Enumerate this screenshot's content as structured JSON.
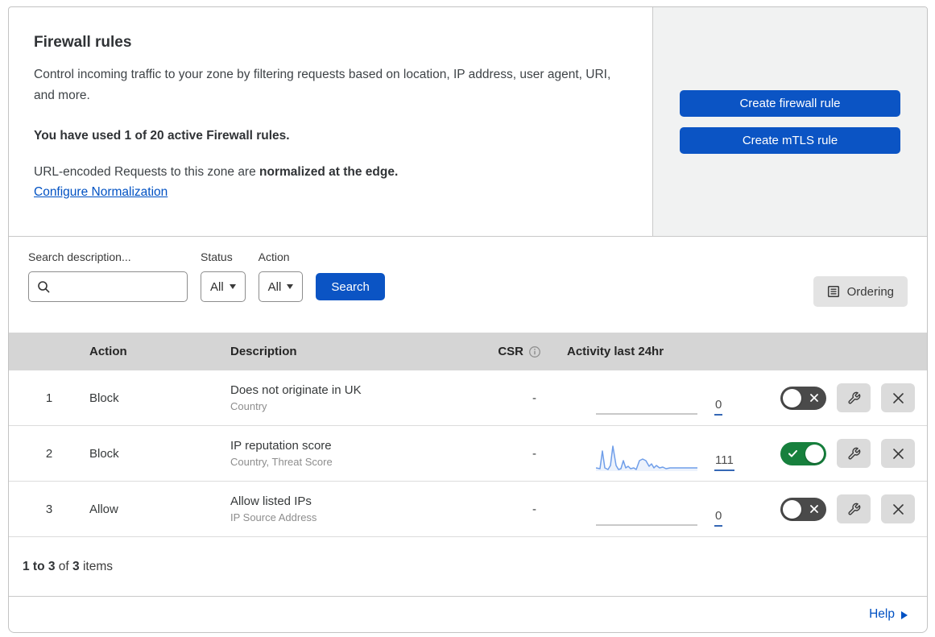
{
  "header": {
    "title": "Firewall rules",
    "description": "Control incoming traffic to your zone by filtering requests based on location, IP address, user agent, URI, and more.",
    "usage": "You have used 1 of 20 active Firewall rules.",
    "normalization_prefix": "URL-encoded Requests to this zone are ",
    "normalization_bold": "normalized at the edge.",
    "configure_link": "Configure Normalization",
    "create_firewall_button": "Create firewall rule",
    "create_mtls_button": "Create mTLS rule"
  },
  "filters": {
    "search_label": "Search description...",
    "search_value": "",
    "status_label": "Status",
    "status_value": "All",
    "action_label": "Action",
    "action_value": "All",
    "search_button": "Search",
    "ordering_button": "Ordering"
  },
  "table": {
    "columns": {
      "action": "Action",
      "description": "Description",
      "csr": "CSR",
      "activity": "Activity last 24hr"
    },
    "rows": [
      {
        "index": "1",
        "action": "Block",
        "description": "Does not originate in UK",
        "criteria": "Country",
        "csr": "-",
        "activity_count": "0",
        "enabled": false,
        "has_sparkline": false
      },
      {
        "index": "2",
        "action": "Block",
        "description": "IP reputation score",
        "criteria": "Country, Threat Score",
        "csr": "-",
        "activity_count": "111",
        "enabled": true,
        "has_sparkline": true,
        "sparkline_points": [
          [
            0,
            34
          ],
          [
            5,
            35
          ],
          [
            8,
            13
          ],
          [
            11,
            34
          ],
          [
            15,
            36
          ],
          [
            18,
            31
          ],
          [
            21,
            7
          ],
          [
            25,
            31
          ],
          [
            28,
            36
          ],
          [
            31,
            35
          ],
          [
            34,
            25
          ],
          [
            37,
            34
          ],
          [
            40,
            32
          ],
          [
            43,
            35
          ],
          [
            47,
            34
          ],
          [
            50,
            36
          ],
          [
            54,
            25
          ],
          [
            58,
            23
          ],
          [
            62,
            25
          ],
          [
            66,
            32
          ],
          [
            69,
            29
          ],
          [
            72,
            34
          ],
          [
            75,
            31
          ],
          [
            79,
            34
          ],
          [
            83,
            33
          ],
          [
            87,
            35
          ],
          [
            92,
            34
          ],
          [
            98,
            34
          ],
          [
            106,
            34
          ],
          [
            114,
            34
          ],
          [
            126,
            34
          ]
        ]
      },
      {
        "index": "3",
        "action": "Allow",
        "description": "Allow listed IPs",
        "criteria": "IP Source Address",
        "csr": "-",
        "activity_count": "0",
        "enabled": false,
        "has_sparkline": false
      }
    ]
  },
  "footer": {
    "range_bold": "1 to 3",
    "of_text": " of ",
    "total_bold": "3",
    "items_text": " items",
    "help": "Help"
  },
  "colors": {
    "primary_blue": "#0b54c4",
    "link_blue": "#0051c3",
    "toggle_on_green": "#17803d",
    "toggle_off_grey": "#4a4a4a",
    "sparkline_blue": "#6f9ee9",
    "table_header_grey": "#d5d5d5",
    "panel_grey": "#f1f2f2"
  }
}
